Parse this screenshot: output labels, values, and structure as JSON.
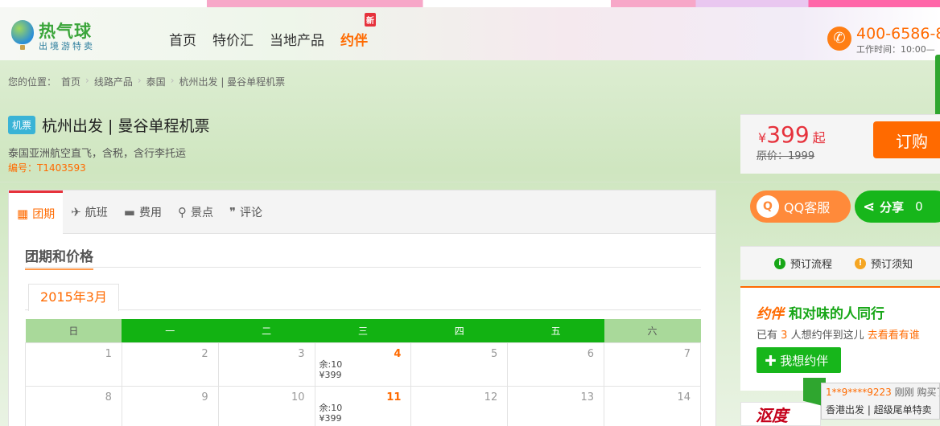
{
  "header": {
    "logo": {
      "name": "热气球",
      "sub": "出境游特卖"
    },
    "nav": [
      {
        "label": "首页"
      },
      {
        "label": "特价汇"
      },
      {
        "label": "当地产品"
      },
      {
        "label": "约伴",
        "badge": "新"
      }
    ],
    "phone": "400-6586-8",
    "work_time": "工作时间：10:00—"
  },
  "breadcrumb": {
    "prefix": "您的位置：",
    "items": [
      "首页",
      "线路产品",
      "泰国",
      "杭州出发 | 曼谷单程机票"
    ]
  },
  "product": {
    "tag": "机票",
    "title": "杭州出发 | 曼谷单程机票",
    "desc": "泰国亚洲航空直飞，含税，含行李托运",
    "code": "编号：T1403593"
  },
  "price": {
    "currency": "¥",
    "value": "399",
    "suffix": "起",
    "original": "原价：1999",
    "buy_label": "订购"
  },
  "tabs": [
    {
      "label": "团期",
      "icon": "calendar-icon",
      "active": true
    },
    {
      "label": "航班",
      "icon": "plane-icon"
    },
    {
      "label": "费用",
      "icon": "wallet-icon"
    },
    {
      "label": "景点",
      "icon": "location-pin-icon"
    },
    {
      "label": "评论",
      "icon": "quote-icon"
    }
  ],
  "section_title": "团期和价格",
  "month_tab": "2015年3月",
  "calendar": {
    "weekdays": [
      "日",
      "一",
      "二",
      "三",
      "四",
      "五",
      "六"
    ],
    "weeks": [
      [
        {
          "day": "1"
        },
        {
          "day": "2"
        },
        {
          "day": "3"
        },
        {
          "day": "4",
          "avail": true,
          "remain": "余:10",
          "price": "¥399"
        },
        {
          "day": "5"
        },
        {
          "day": "6"
        },
        {
          "day": "7"
        }
      ],
      [
        {
          "day": "8"
        },
        {
          "day": "9"
        },
        {
          "day": "10"
        },
        {
          "day": "11",
          "avail": true,
          "remain": "余:10",
          "price": "¥399"
        },
        {
          "day": "12"
        },
        {
          "day": "13"
        },
        {
          "day": "14"
        }
      ]
    ]
  },
  "side": {
    "qq_label": "QQ客服",
    "share_label": "分享",
    "share_count": "0",
    "notice": [
      "预订流程",
      "预订须知"
    ],
    "yueban": {
      "logo": "约伴",
      "title": "和对味的人同行",
      "line_pre": "已有",
      "count": "3",
      "line_post": "人想约伴到这儿",
      "link": "去看看有谁",
      "join_label": "我想约伴"
    },
    "float_notice": {
      "who": "1**9****9223",
      "action": "刚刚 购买了",
      "item": "香港出发 | 超级尾单特卖"
    },
    "ad_text": "沤度"
  },
  "colors": {
    "accent": "#ff6a00",
    "green": "#12b212",
    "red": "#e6323c"
  }
}
